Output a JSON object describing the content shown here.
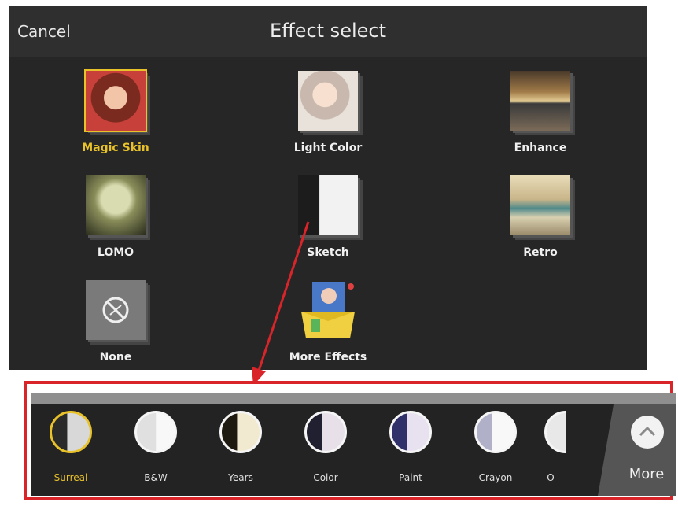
{
  "header": {
    "cancel_label": "Cancel",
    "title": "Effect select"
  },
  "effects": [
    {
      "label": "Magic Skin",
      "icon": "face-portrait-icon",
      "selected": true
    },
    {
      "label": "Light Color",
      "icon": "light-portrait-icon",
      "selected": false
    },
    {
      "label": "Enhance",
      "icon": "pier-sunset-icon",
      "selected": false
    },
    {
      "label": "LOMO",
      "icon": "city-vignette-icon",
      "selected": false
    },
    {
      "label": "Sketch",
      "icon": "sketch-portrait-icon",
      "selected": false
    },
    {
      "label": "Retro",
      "icon": "retro-van-icon",
      "selected": false
    },
    {
      "label": "None",
      "icon": "no-effect-icon",
      "selected": false
    },
    {
      "label": "More Effects",
      "icon": "effects-box-icon",
      "selected": false
    }
  ],
  "strip": {
    "items": [
      {
        "label": "Surreal",
        "selected": true
      },
      {
        "label": "B&W",
        "selected": false
      },
      {
        "label": "Years",
        "selected": false
      },
      {
        "label": "Color",
        "selected": false
      },
      {
        "label": "Paint",
        "selected": false
      },
      {
        "label": "Crayon",
        "selected": false
      },
      {
        "label": "O",
        "selected": false
      }
    ],
    "more_label": "More"
  },
  "colors": {
    "accent": "#e8c228",
    "highlight_frame": "#d9252a",
    "panel_bg": "#262626"
  }
}
